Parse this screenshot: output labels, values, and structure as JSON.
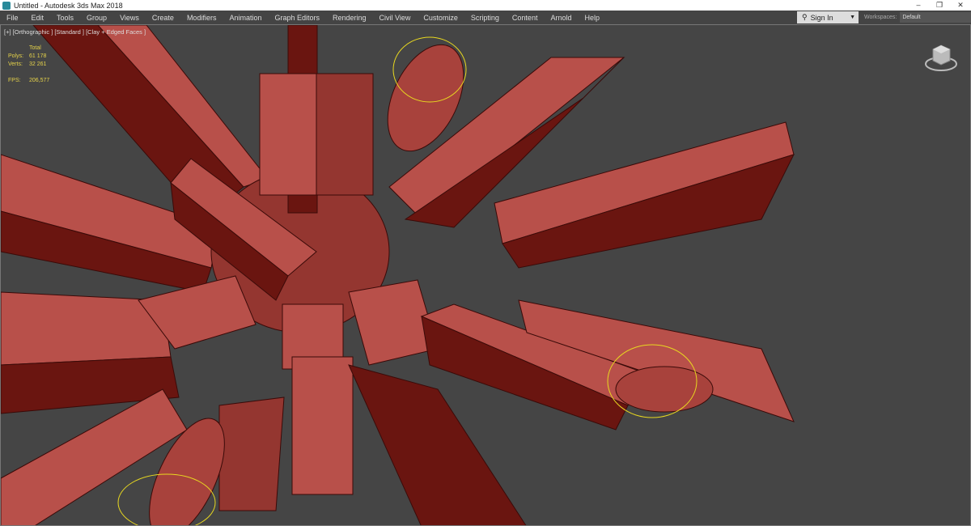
{
  "window": {
    "title": "Untitled - Autodesk 3ds Max 2018",
    "controls": [
      "–",
      "❐",
      "✕"
    ]
  },
  "menu": [
    "File",
    "Edit",
    "Tools",
    "Group",
    "Views",
    "Create",
    "Modifiers",
    "Animation",
    "Graph Editors",
    "Rendering",
    "Civil View",
    "Customize",
    "Scripting",
    "Content",
    "Arnold",
    "Help"
  ],
  "signin": {
    "label": "Sign In",
    "caret": "▼"
  },
  "workspaces": {
    "label": "Workspaces:",
    "value": "Default"
  },
  "viewport": {
    "label": "[+] [Orthographic ] [Standard ] [Clay + Edged Faces ]",
    "stats": {
      "header": "Total",
      "polys_label": "Polys:",
      "polys": "61 178",
      "verts_label": "Verts:",
      "verts": "32 261",
      "fps_label": "FPS:",
      "fps": "206,577"
    }
  },
  "colors": {
    "light": "#b8504a",
    "dark": "#6a1510",
    "mid": "#943630",
    "gizmo": "#e8d820"
  }
}
